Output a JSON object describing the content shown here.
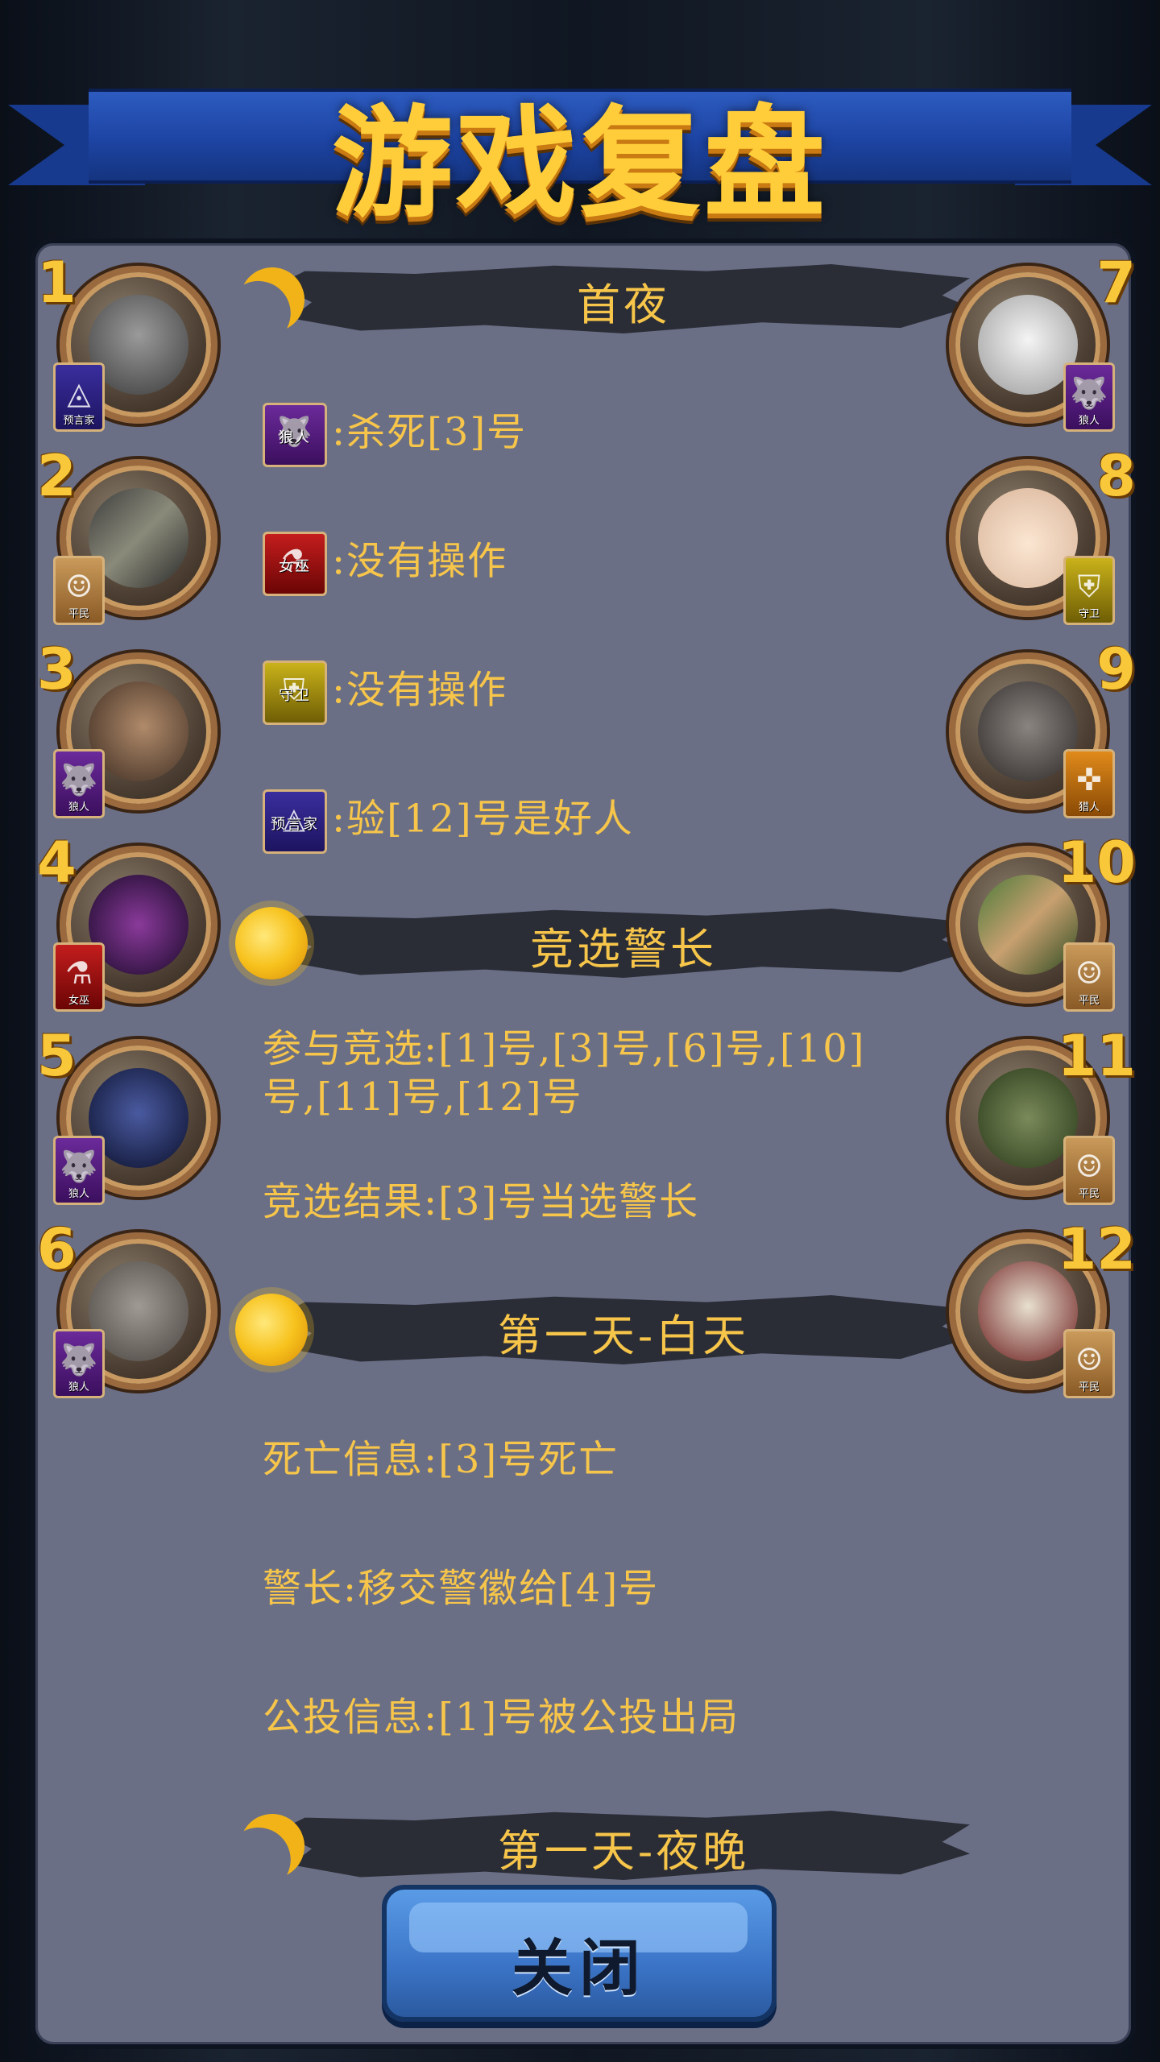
{
  "title": "游戏复盘",
  "players_left": [
    {
      "number": "1",
      "role_label": "预言家",
      "role": "seer"
    },
    {
      "number": "2",
      "role_label": "平民",
      "role": "villager"
    },
    {
      "number": "3",
      "role_label": "狼人",
      "role": "wolf"
    },
    {
      "number": "4",
      "role_label": "女巫",
      "role": "witch"
    },
    {
      "number": "5",
      "role_label": "狼人",
      "role": "wolf"
    },
    {
      "number": "6",
      "role_label": "狼人",
      "role": "wolf"
    }
  ],
  "players_right": [
    {
      "number": "7",
      "role_label": "狼人",
      "role": "wolf"
    },
    {
      "number": "8",
      "role_label": "守卫",
      "role": "guard"
    },
    {
      "number": "9",
      "role_label": "猎人",
      "role": "hunter"
    },
    {
      "number": "10",
      "role_label": "平民",
      "role": "villager"
    },
    {
      "number": "11",
      "role_label": "平民",
      "role": "villager"
    },
    {
      "number": "12",
      "role_label": "平民",
      "role": "villager"
    }
  ],
  "sections": {
    "first_night": {
      "title": "首夜",
      "wolf_badge": "狼人",
      "wolf_action": ":杀死[3]号",
      "witch_badge": "女巫",
      "witch_action": ":没有操作",
      "guard_badge": "守卫",
      "guard_action": ":没有操作",
      "seer_badge": "预言家",
      "seer_action": ":验[12]号是好人"
    },
    "sheriff": {
      "title": "竞选警长",
      "participants": "参与竞选:[1]号,[3]号,[6]号,[10]号,[11]号,[12]号",
      "result": "竞选结果:[3]号当选警长"
    },
    "day1": {
      "title": "第一天-白天",
      "death": "死亡信息:[3]号死亡",
      "sheriff_transfer": "警长:移交警徽给[4]号",
      "vote": "公投信息:[1]号被公投出局"
    },
    "night1": {
      "title": "第一天-夜晚"
    }
  },
  "close_button": "关闭"
}
